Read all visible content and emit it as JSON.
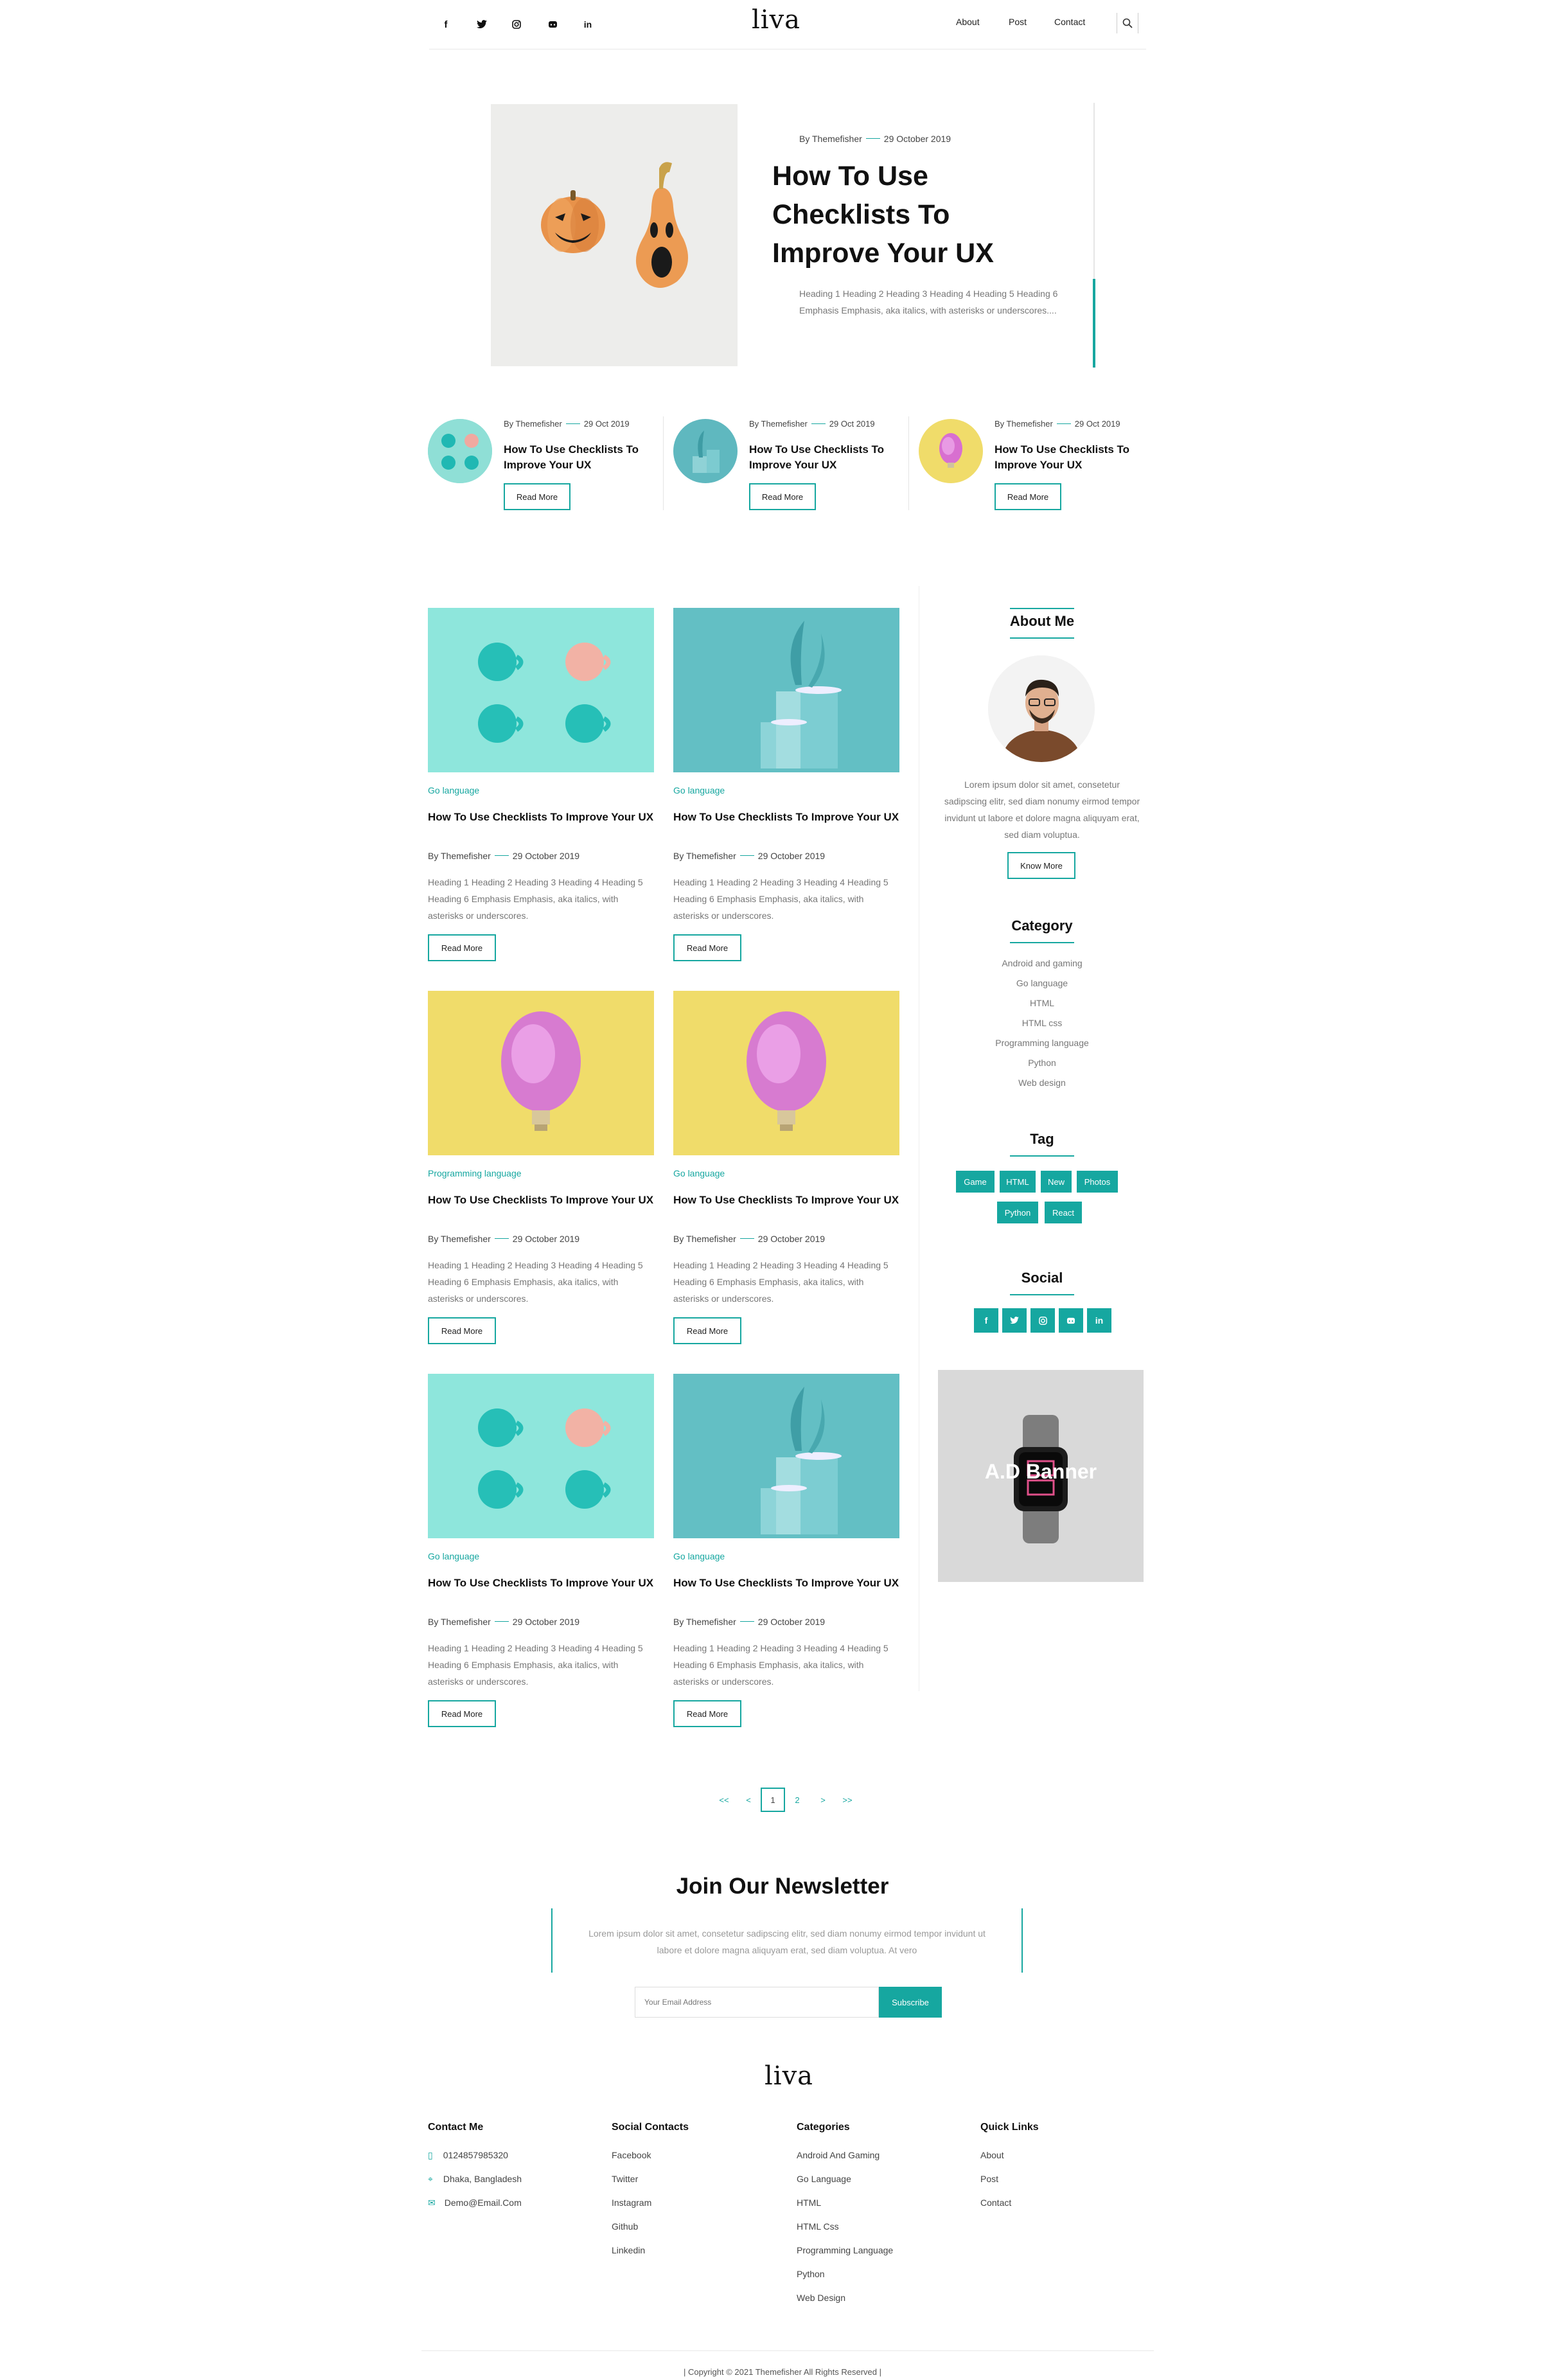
{
  "header": {
    "logo": "liva",
    "social": [
      "f",
      "t",
      "ig",
      "gh",
      "in"
    ],
    "social_icons": [
      "facebook-icon",
      "twitter-icon",
      "instagram-icon",
      "github-icon",
      "linkedin-icon"
    ],
    "nav": [
      "About",
      "Post",
      "Contact"
    ]
  },
  "hero": {
    "author": "By Themefisher",
    "date": "29 October 2019",
    "title": "How To Use Checklists To Improve Your UX",
    "excerpt": "Heading 1 Heading 2 Heading 3 Heading 4 Heading 5 Heading 6 Emphasis Emphasis, aka italics, with asterisks or underscores...."
  },
  "featured": [
    {
      "author": "By Themefisher",
      "date": "29 Oct 2019",
      "title": "How To Use Checklists To Improve Your UX",
      "button": "Read More"
    },
    {
      "author": "By Themefisher",
      "date": "29 Oct 2019",
      "title": "How To Use Checklists To Improve Your UX",
      "button": "Read More"
    },
    {
      "author": "By Themefisher",
      "date": "29 Oct 2019",
      "title": "How To Use Checklists To Improve Your UX",
      "button": "Read More"
    }
  ],
  "posts": [
    {
      "category": "Go language",
      "title": "How To Use Checklists To Improve Your UX",
      "author": "By Themefisher",
      "date": "29 October 2019",
      "excerpt": "Heading 1 Heading 2 Heading 3 Heading 4 Heading 5 Heading 6 Emphasis Emphasis, aka italics, with asterisks or underscores.",
      "button": "Read More"
    },
    {
      "category": "Go language",
      "title": "How To Use Checklists To Improve Your UX",
      "author": "By Themefisher",
      "date": "29 October 2019",
      "excerpt": "Heading 1 Heading 2 Heading 3 Heading 4 Heading 5 Heading 6 Emphasis Emphasis, aka italics, with asterisks or underscores.",
      "button": "Read More"
    },
    {
      "category": "Programming language",
      "title": "How To Use Checklists To Improve Your UX",
      "author": "By Themefisher",
      "date": "29 October 2019",
      "excerpt": "Heading 1 Heading 2 Heading 3 Heading 4 Heading 5 Heading 6 Emphasis Emphasis, aka italics, with asterisks or underscores.",
      "button": "Read More"
    },
    {
      "category": "Go language",
      "title": "How To Use Checklists To Improve Your UX",
      "author": "By Themefisher",
      "date": "29 October 2019",
      "excerpt": "Heading 1 Heading 2 Heading 3 Heading 4 Heading 5 Heading 6 Emphasis Emphasis, aka italics, with asterisks or underscores.",
      "button": "Read More"
    },
    {
      "category": "Go language",
      "title": "How To Use Checklists To Improve Your UX",
      "author": "By Themefisher",
      "date": "29 October 2019",
      "excerpt": "Heading 1 Heading 2 Heading 3 Heading 4 Heading 5 Heading 6 Emphasis Emphasis, aka italics, with asterisks or underscores.",
      "button": "Read More"
    },
    {
      "category": "Go language",
      "title": "How To Use Checklists To Improve Your UX",
      "author": "By Themefisher",
      "date": "29 October 2019",
      "excerpt": "Heading 1 Heading 2 Heading 3 Heading 4 Heading 5 Heading 6 Emphasis Emphasis, aka italics, with asterisks or underscores.",
      "button": "Read More"
    }
  ],
  "sidebar": {
    "about_title": "About Me",
    "about_text": "Lorem ipsum dolor sit amet, consetetur sadipscing elitr, sed diam nonumy eirmod tempor invidunt ut labore et dolore magna aliquyam erat, sed diam voluptua.",
    "about_button": "Know More",
    "category_title": "Category",
    "categories": [
      "Android and gaming",
      "Go language",
      "HTML",
      "HTML css",
      "Programming language",
      "Python",
      "Web design"
    ],
    "tag_title": "Tag",
    "tags": [
      "Game",
      "HTML",
      "New",
      "Photos",
      "Python",
      "React"
    ],
    "social_title": "Social",
    "social": [
      "f",
      "t",
      "ig",
      "gh",
      "in"
    ],
    "social_icons": [
      "facebook-icon",
      "twitter-icon",
      "instagram-icon",
      "github-icon",
      "linkedin-icon"
    ],
    "ad_text": "A.D Banner"
  },
  "pagination": [
    "<<",
    "<",
    "1",
    "2",
    ">",
    ">>"
  ],
  "newsletter": {
    "title": "Join Our Newsletter",
    "text": "Lorem ipsum dolor sit amet, consetetur sadipscing elitr, sed diam nonumy eirmod tempor invidunt ut labore et dolore magna aliquyam erat, sed diam voluptua. At vero",
    "placeholder": "Your Email Address",
    "button": "Subscribe"
  },
  "footer": {
    "logo": "liva",
    "contact_title": "Contact Me",
    "contact": [
      "0124857985320",
      "Dhaka, Bangladesh",
      "Demo@Email.Com"
    ],
    "social_title": "Social Contacts",
    "social": [
      "Facebook",
      "Twitter",
      "Instagram",
      "Github",
      "Linkedin"
    ],
    "categories_title": "Categories",
    "categories": [
      "Android And Gaming",
      "Go Language",
      "HTML",
      "HTML Css",
      "Programming Language",
      "Python",
      "Web Design"
    ],
    "links_title": "Quick Links",
    "links": [
      "About",
      "Post",
      "Contact"
    ],
    "copyright": "| Copyright © 2021 Themefisher All Rights Reserved |"
  },
  "colors": {
    "accent": "#16a7a0"
  }
}
